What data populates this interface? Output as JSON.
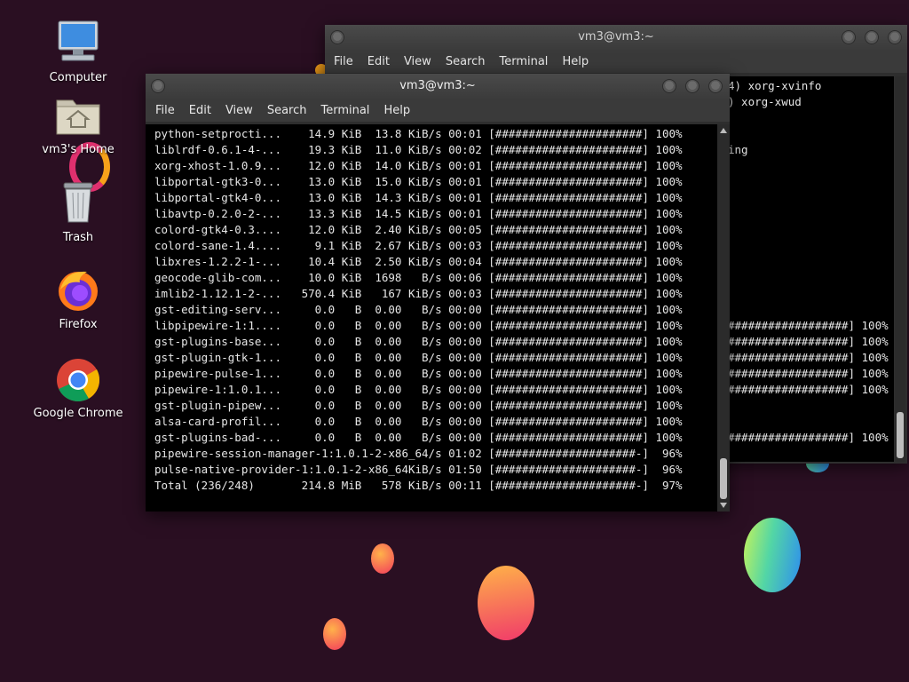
{
  "desktop": {
    "icons": [
      {
        "label": "Computer",
        "icon": "computer-icon"
      },
      {
        "label": "vm3's Home",
        "icon": "home-folder-icon"
      },
      {
        "label": "Trash",
        "icon": "trash-icon"
      },
      {
        "label": "Firefox",
        "icon": "firefox-icon"
      },
      {
        "label": "Google Chrome",
        "icon": "chrome-icon"
      }
    ]
  },
  "back_window": {
    "title": "vm3@vm3:~",
    "menu": [
      "File",
      "Edit",
      "View",
      "Search",
      "Terminal",
      "Help"
    ],
    "visible_lines": [
      "4) xorg-xvinfo",
      ") xorg-xwud",
      "",
      "",
      "ing",
      "",
      "",
      "",
      "",
      "",
      "",
      "",
      "",
      "",
      "",
      "##################] 100%",
      "##################] 100%",
      "##################] 100%",
      "##################] 100%",
      "##################] 100%",
      "",
      "",
      "##################] 100%"
    ]
  },
  "front_window": {
    "title": "vm3@vm3:~",
    "menu": [
      "File",
      "Edit",
      "View",
      "Search",
      "Terminal",
      "Help"
    ],
    "lines": [
      "python-setprocti...    14.9 KiB  13.8 KiB/s 00:01 [######################] 100%",
      "liblrdf-0.6.1-4-...    19.3 KiB  11.0 KiB/s 00:02 [######################] 100%",
      "xorg-xhost-1.0.9...    12.0 KiB  14.0 KiB/s 00:01 [######################] 100%",
      "libportal-gtk3-0...    13.0 KiB  15.0 KiB/s 00:01 [######################] 100%",
      "libportal-gtk4-0...    13.0 KiB  14.3 KiB/s 00:01 [######################] 100%",
      "libavtp-0.2.0-2-...    13.3 KiB  14.5 KiB/s 00:01 [######################] 100%",
      "colord-gtk4-0.3....    12.0 KiB  2.40 KiB/s 00:05 [######################] 100%",
      "colord-sane-1.4....     9.1 KiB  2.67 KiB/s 00:03 [######################] 100%",
      "libxres-1.2.2-1-...    10.4 KiB  2.50 KiB/s 00:04 [######################] 100%",
      "geocode-glib-com...    10.0 KiB  1698   B/s 00:06 [######################] 100%",
      "imlib2-1.12.1-2-...   570.4 KiB   167 KiB/s 00:03 [######################] 100%",
      "gst-editing-serv...     0.0   B  0.00   B/s 00:00 [######################] 100%",
      "libpipewire-1:1....     0.0   B  0.00   B/s 00:00 [######################] 100%",
      "gst-plugins-base...     0.0   B  0.00   B/s 00:00 [######################] 100%",
      "gst-plugin-gtk-1...     0.0   B  0.00   B/s 00:00 [######################] 100%",
      "pipewire-pulse-1...     0.0   B  0.00   B/s 00:00 [######################] 100%",
      "pipewire-1:1.0.1...     0.0   B  0.00   B/s 00:00 [######################] 100%",
      "gst-plugin-pipew...     0.0   B  0.00   B/s 00:00 [######################] 100%",
      "alsa-card-profil...     0.0   B  0.00   B/s 00:00 [######################] 100%",
      "gst-plugins-bad-...     0.0   B  0.00   B/s 00:00 [######################] 100%",
      "pipewire-session-manager-1:1.0.1-2-x86_64/s 01:02 [#####################-]  96%",
      "pulse-native-provider-1:1.0.1-2-x86_64KiB/s 01:50 [#####################-]  96%",
      "Total (236/248)       214.8 MiB   578 KiB/s 00:11 [#####################-]  97%"
    ]
  }
}
